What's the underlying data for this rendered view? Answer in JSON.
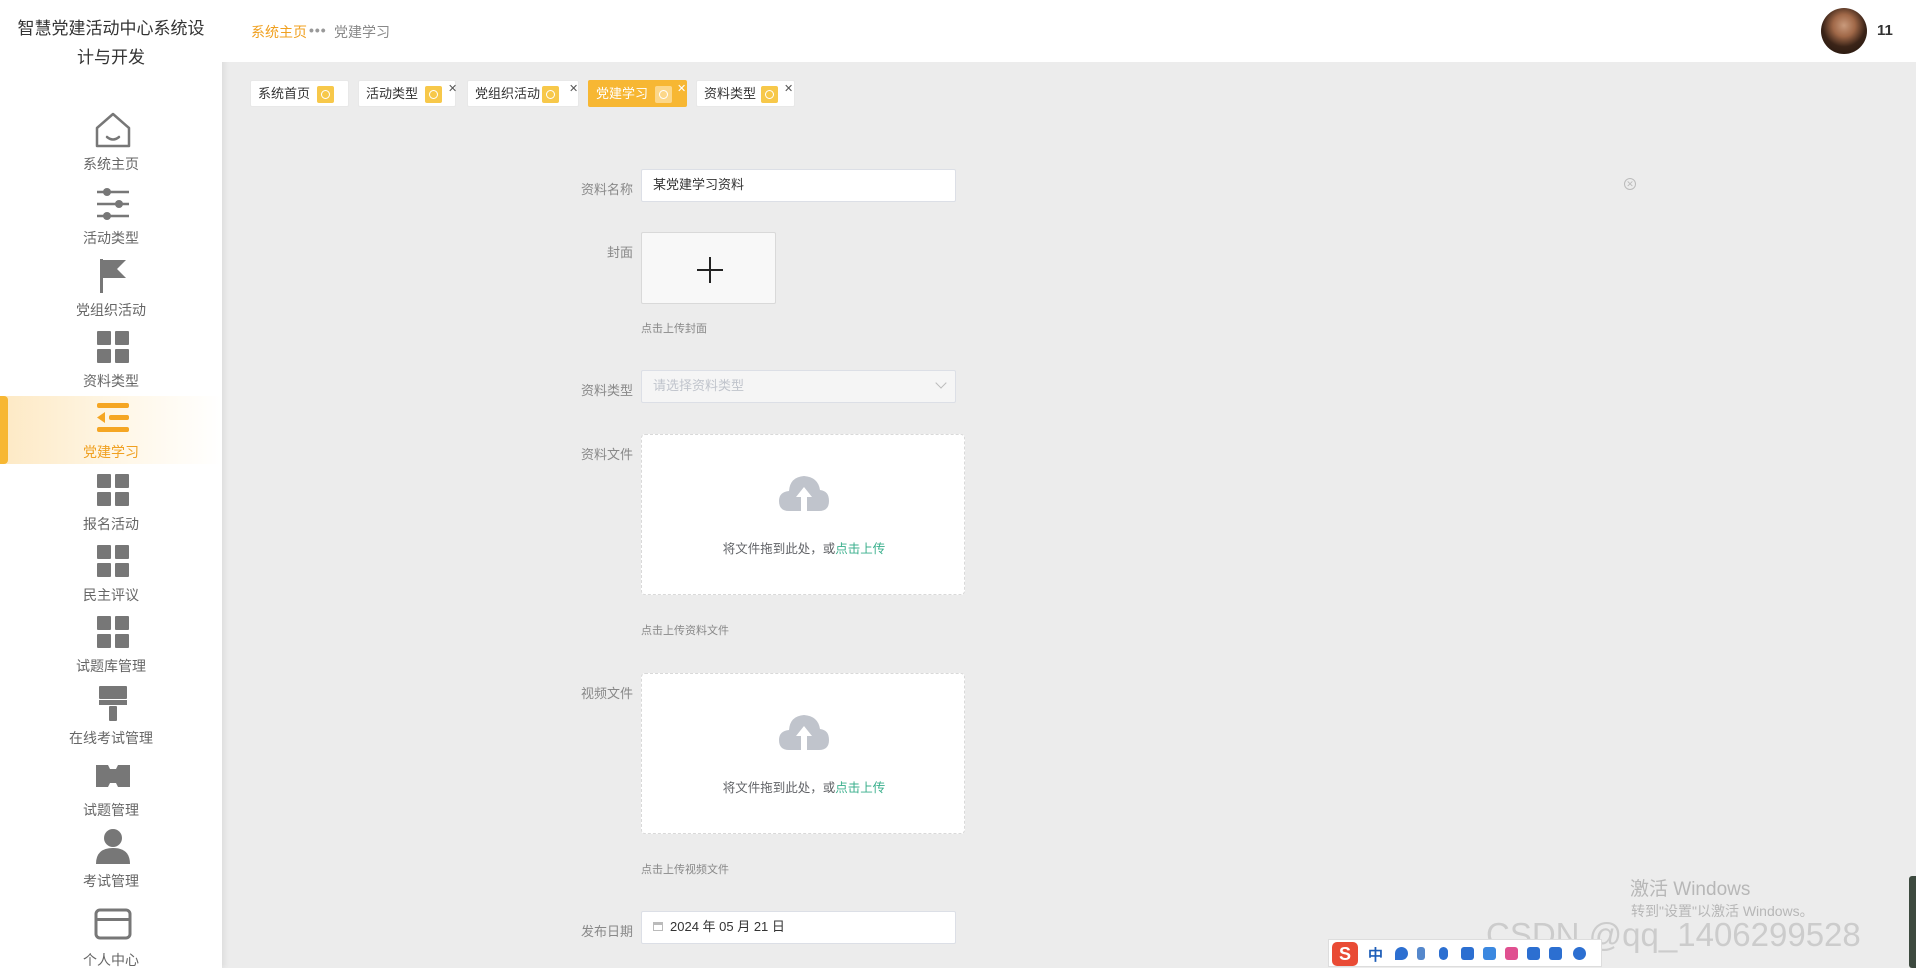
{
  "app": {
    "title": "智慧党建活动中心系统设计与开发"
  },
  "sidebar": {
    "items": [
      {
        "label": "系统主页",
        "icon": "home-icon"
      },
      {
        "label": "活动类型",
        "icon": "sliders-icon"
      },
      {
        "label": "党组织活动",
        "icon": "flag-icon"
      },
      {
        "label": "资料类型",
        "icon": "grid-icon"
      },
      {
        "label": "党建学习",
        "icon": "list-indent-icon",
        "active": true
      },
      {
        "label": "报名活动",
        "icon": "grid-icon"
      },
      {
        "label": "民主评议",
        "icon": "grid-icon"
      },
      {
        "label": "试题库管理",
        "icon": "grid-icon"
      },
      {
        "label": "在线考试管理",
        "icon": "brush-icon"
      },
      {
        "label": "试题管理",
        "icon": "ticket-icon"
      },
      {
        "label": "考试管理",
        "icon": "user-icon"
      },
      {
        "label": "个人中心",
        "icon": "card-icon"
      }
    ]
  },
  "header": {
    "breadcrumb": {
      "home": "系统主页",
      "current": "党建学习"
    },
    "username": "11"
  },
  "tabs": [
    {
      "label": "系统首页",
      "active": false,
      "closable": false
    },
    {
      "label": "活动类型",
      "active": false,
      "closable": true
    },
    {
      "label": "党组织活动",
      "active": false,
      "closable": true
    },
    {
      "label": "党建学习",
      "active": true,
      "closable": true
    },
    {
      "label": "资料类型",
      "active": false,
      "closable": true
    }
  ],
  "form": {
    "name": {
      "label": "资料名称",
      "value": "某党建学习资料"
    },
    "cover": {
      "label": "封面",
      "hint": "点击上传封面"
    },
    "type": {
      "label": "资料类型",
      "placeholder": "请选择资料类型"
    },
    "file": {
      "label": "资料文件",
      "drop_text": "将文件拖到此处，或",
      "link_text": "点击上传",
      "hint": "点击上传资料文件"
    },
    "video": {
      "label": "视频文件",
      "drop_text": "将文件拖到此处，或",
      "link_text": "点击上传",
      "hint": "点击上传视频文件"
    },
    "date": {
      "label": "发布日期",
      "value": "2024 年 05 月 21 日"
    }
  },
  "overlay": {
    "windows_line1": "激活 Windows",
    "windows_line2": "转到\"设置\"以激活 Windows。",
    "csdn": "CSDN @qq_1406299528",
    "ime_logo": "S",
    "ime_mode": "中"
  },
  "colors": {
    "accent": "#f7b733",
    "link": "#3aaf8c"
  }
}
